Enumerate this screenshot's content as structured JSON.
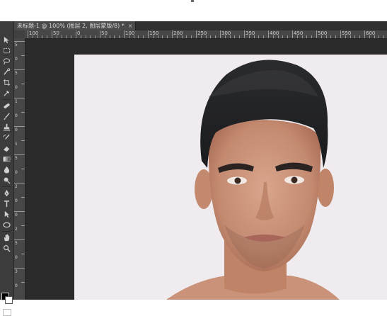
{
  "document": {
    "tab_title": "未标题-1 @ 100% (图层 2, 图层蒙版/8) *",
    "tab_close": "×"
  },
  "ruler": {
    "horizontal_labels": [
      "100",
      "50",
      "0",
      "50",
      "100",
      "150",
      "200",
      "250",
      "300",
      "350",
      "400",
      "450",
      "500",
      "550",
      "600"
    ],
    "vertical_labels": [
      "5",
      "0",
      "5",
      "0",
      "1",
      "0",
      "0",
      "1",
      "5",
      "0",
      "2",
      "0",
      "0",
      "2",
      "5",
      "0",
      "3",
      "0"
    ]
  },
  "toolbox": {
    "tools": [
      "move-tool",
      "marquee-tool",
      "lasso-tool",
      "quick-select-tool",
      "crop-tool",
      "eyedropper-tool",
      "healing-brush-tool",
      "brush-tool",
      "clone-stamp-tool",
      "history-brush-tool",
      "eraser-tool",
      "gradient-tool",
      "blur-tool",
      "dodge-tool",
      "pen-tool",
      "type-tool",
      "path-select-tool",
      "shape-tool",
      "hand-tool",
      "zoom-tool"
    ]
  },
  "colors": {
    "foreground": "#000000",
    "background": "#ffffff",
    "workspace": "#2b2b2b",
    "panel": "#3c3c3c",
    "photo_backdrop": "#efebee"
  },
  "canvas": {
    "content": "portrait-photo"
  }
}
